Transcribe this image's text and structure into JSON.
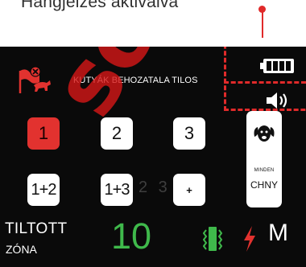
{
  "callout": {
    "text": "Hangjelzés aktiválva"
  },
  "header": {
    "warning_text": "KUTYÁK BEHOZATALA TILOS",
    "icons": [
      "no-dogs-icon",
      "battery-icon",
      "speaker-icon"
    ]
  },
  "status": {
    "battery_bars": 4,
    "sound_on": true
  },
  "keypad": {
    "row1": [
      "1",
      "2",
      "3"
    ],
    "row2": [
      "1+2",
      "1+3",
      "+"
    ],
    "ghost": "2 3",
    "active": "1"
  },
  "dog_card": {
    "label": "MINDEN",
    "value": "CHNY"
  },
  "footer": {
    "zone_title": "TILTOTT",
    "zone_sub": "ZÓNA",
    "level": "10",
    "mode": "M",
    "icons": [
      "vibrate-icon",
      "shock-bolt-icon"
    ]
  },
  "watermark": {
    "text": "sofit.c"
  },
  "colors": {
    "accent_red": "#e2322f",
    "level_green": "#3fb94b",
    "screen_bg": "#0a0a0a"
  }
}
